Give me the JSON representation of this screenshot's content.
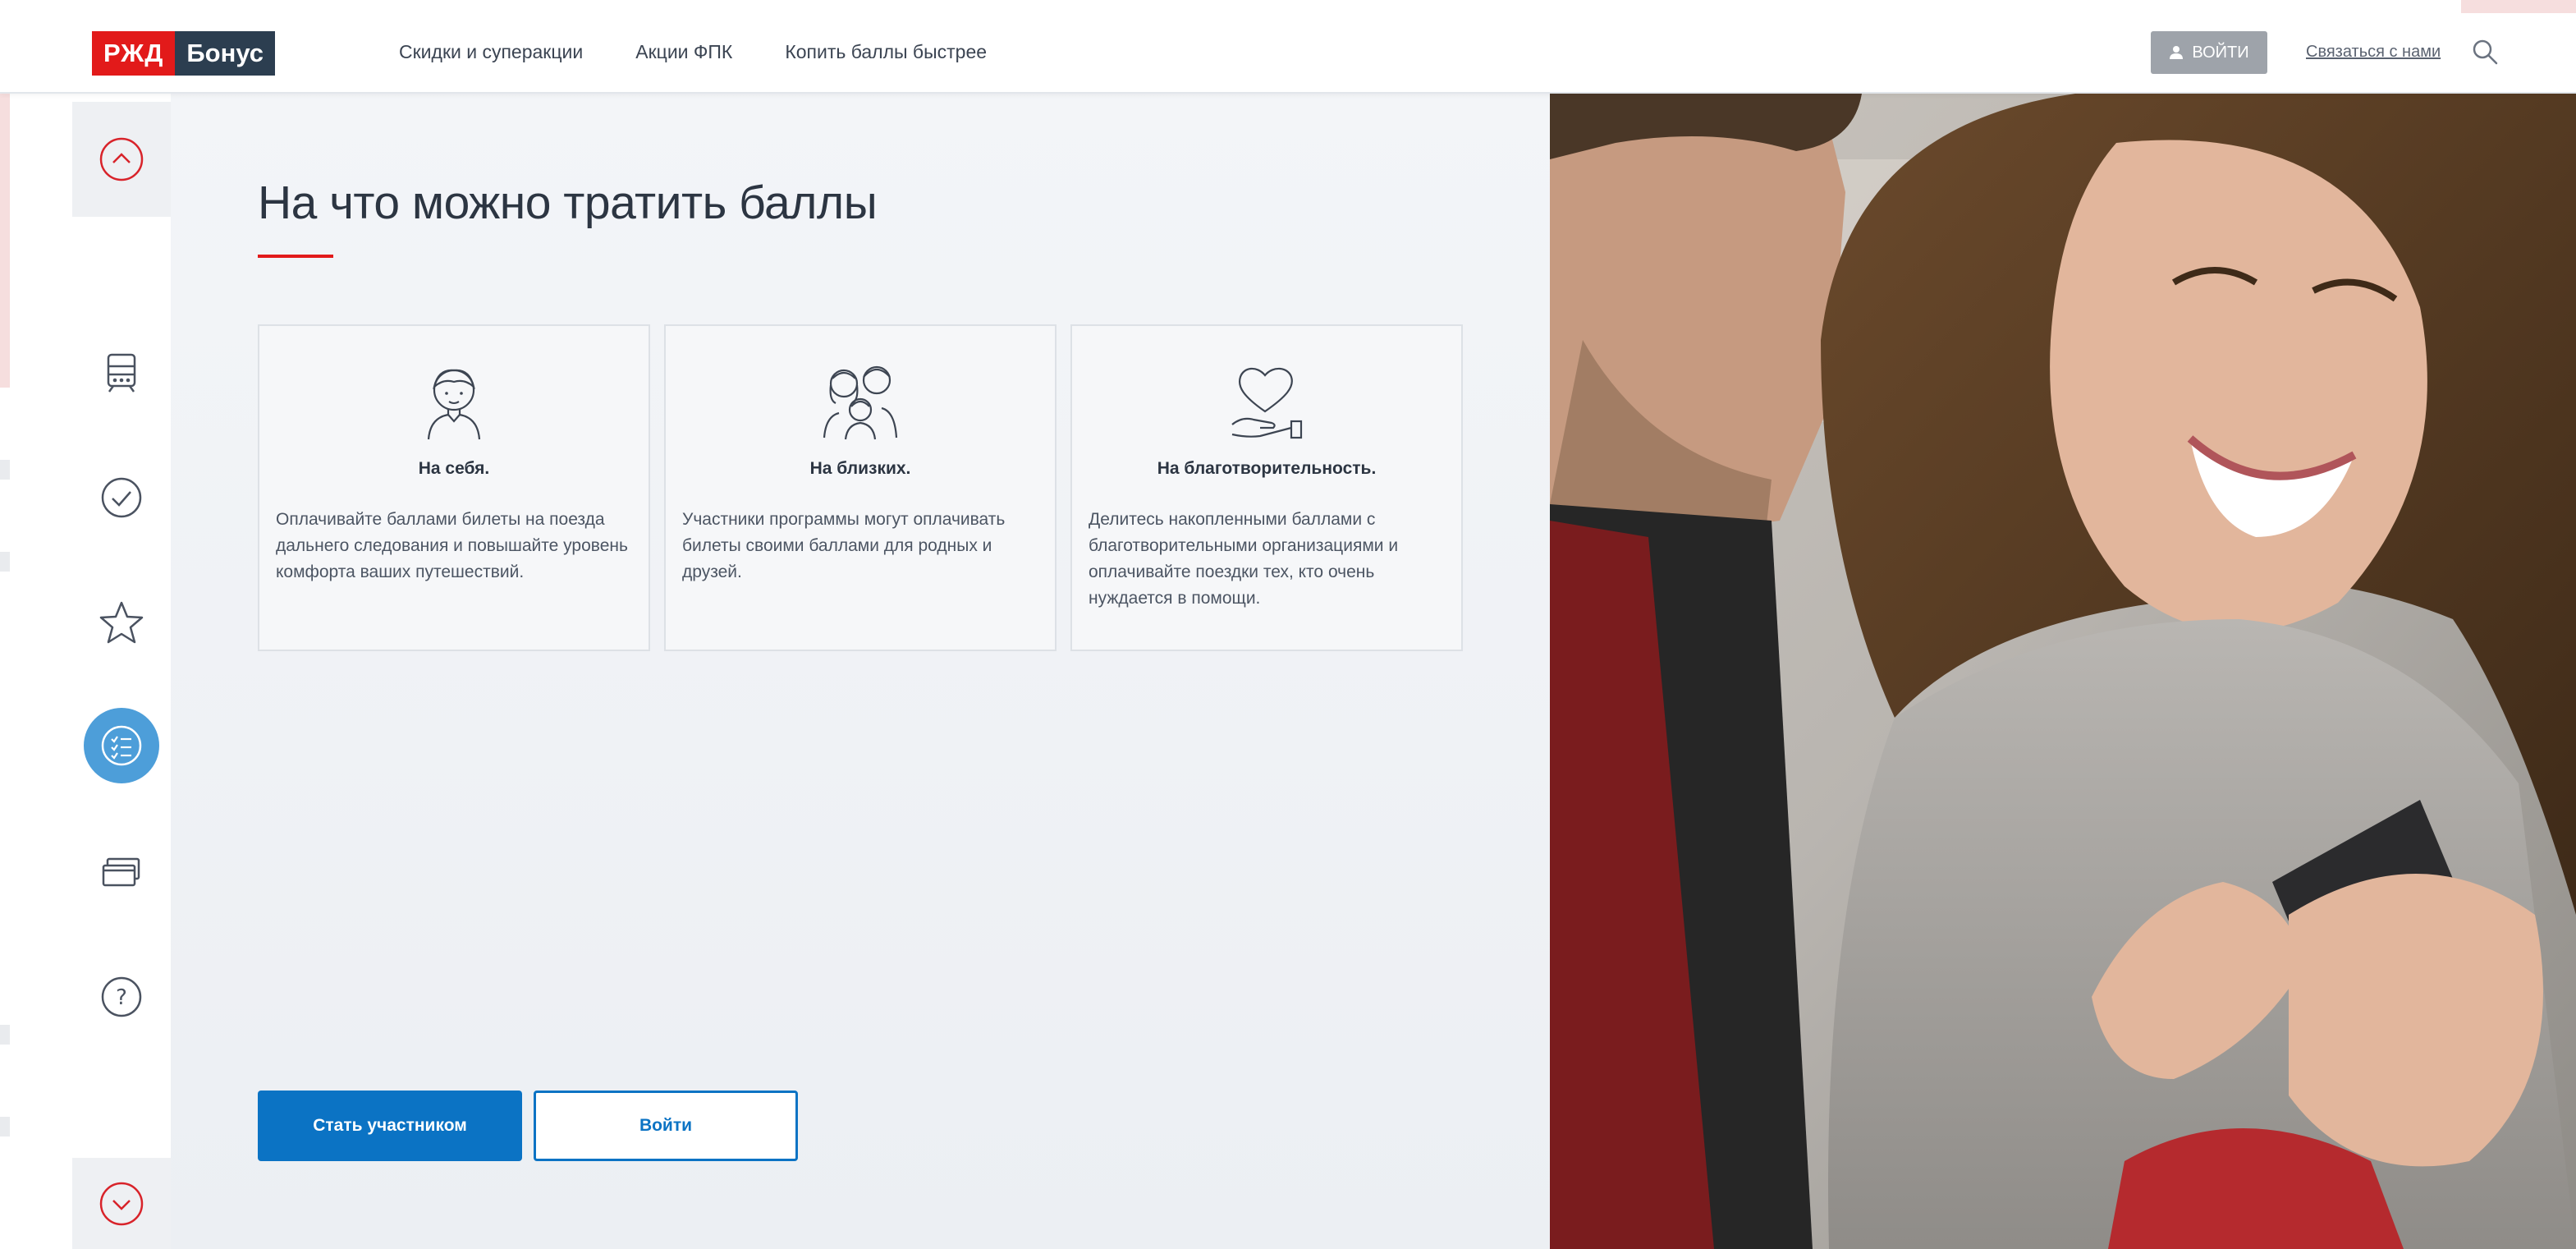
{
  "header": {
    "logo": {
      "part1": "РЖД",
      "part2": "Бонус"
    },
    "nav": [
      "Скидки и суперакции",
      "Акции ФПК",
      "Копить баллы быстрее"
    ],
    "login_label": "Войти",
    "contact_label": "Связаться с нами"
  },
  "sidebar": {
    "items": [
      "chevron-up-icon",
      "train-icon",
      "check-icon",
      "star-icon",
      "list-icon",
      "cards-icon",
      "help-icon",
      "chevron-down-icon"
    ],
    "active_item": "list-icon"
  },
  "main": {
    "title": "На что можно тратить баллы",
    "cards": [
      {
        "icon": "person-icon",
        "title": "На себя.",
        "text": "Оплачивайте баллами билеты на поезда дальнего следования и повышайте уровень комфорта ваших путешествий."
      },
      {
        "icon": "family-icon",
        "title": "На близких.",
        "text": "Участники программы могут оплачивать билеты своими баллами для родных и друзей."
      },
      {
        "icon": "heart-hand-icon",
        "title": "На благотворительность.",
        "text": "Делитесь накопленными баллами с благотворительными организациями и оплачивайте поездки тех, кто очень нуждается в помощи."
      }
    ],
    "primary_button": "Стать участником",
    "secondary_button": "Войти"
  },
  "colors": {
    "brand_red": "#e21a1a",
    "brand_dark": "#2c3e50",
    "primary_blue": "#0b73c4",
    "active_sidebar": "#4d9ed9"
  }
}
